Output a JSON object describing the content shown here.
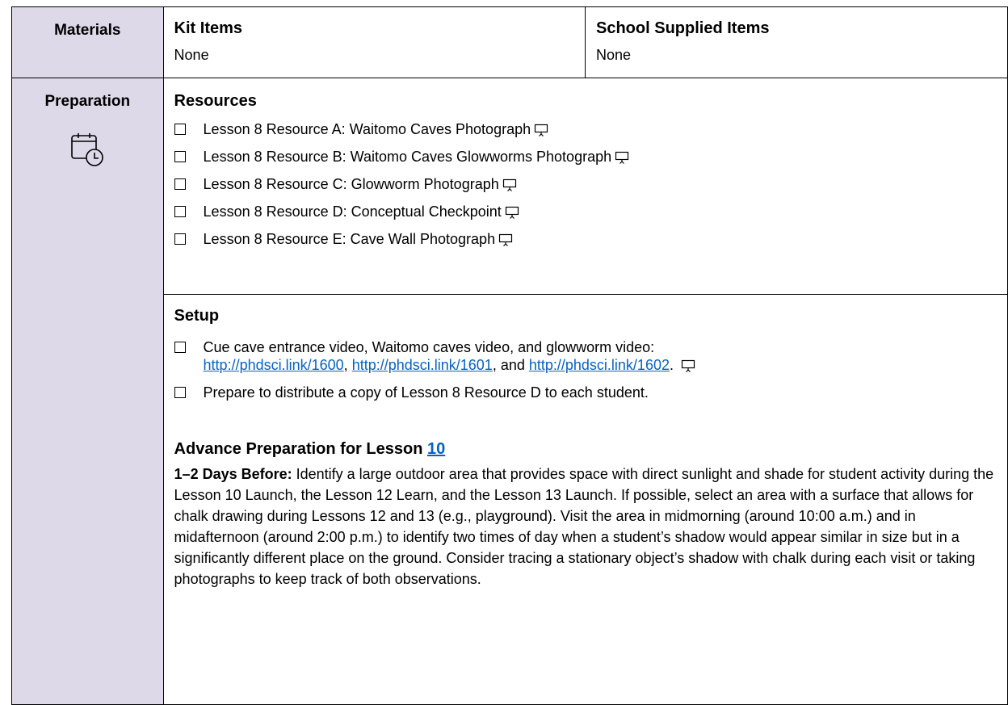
{
  "materials": {
    "label": "Materials",
    "kit_header": "Kit Items",
    "kit_value": "None",
    "school_header": "School Supplied Items",
    "school_value": "None"
  },
  "preparation": {
    "label": "Preparation",
    "icon": "calendar-clock-icon"
  },
  "resources": {
    "header": "Resources",
    "items": [
      "Lesson 8 Resource A: Waitomo Caves Photograph",
      "Lesson 8 Resource B: Waitomo Caves Glowworms Photograph",
      "Lesson 8 Resource C: Glowworm Photograph",
      "Lesson 8 Resource D: Conceptual Checkpoint",
      "Lesson 8 Resource E: Cave Wall Photograph"
    ]
  },
  "setup": {
    "header": "Setup",
    "item1_text": "Cue cave entrance video, Waitomo caves video, and glowworm video:",
    "link1": "http://phdsci.link/1600",
    "sep1": ", ",
    "link2": "http://phdsci.link/1601",
    "sep2": ", and ",
    "link3": "http://phdsci.link/1602",
    "end": ".",
    "item2_text": "Prepare to distribute a copy of Lesson 8 Resource D to each student."
  },
  "advance": {
    "title": "Advance Preparation for Lesson ",
    "lesson_link": "10",
    "lead": "1–2 Days Before:",
    "body": " Identify a large outdoor area that provides space with direct sunlight and shade for student activity during the Lesson 10 Launch, the Lesson 12 Learn, and the Lesson 13 Launch. If possible, select an area with a surface that allows for chalk drawing during Lessons 12 and 13 (e.g., playground). Visit the area in midmorning (around 10:00 a.m.) and in midafternoon (around 2:00 p.m.) to identify two times of day when a student’s shadow would appear similar in size but in a significantly different place on the ground. Consider tracing a stationary object’s shadow with chalk during each visit or taking photographs to keep track of both observations."
  },
  "colors": {
    "side_bg": "#ddd9e8",
    "link": "#0563c1"
  }
}
